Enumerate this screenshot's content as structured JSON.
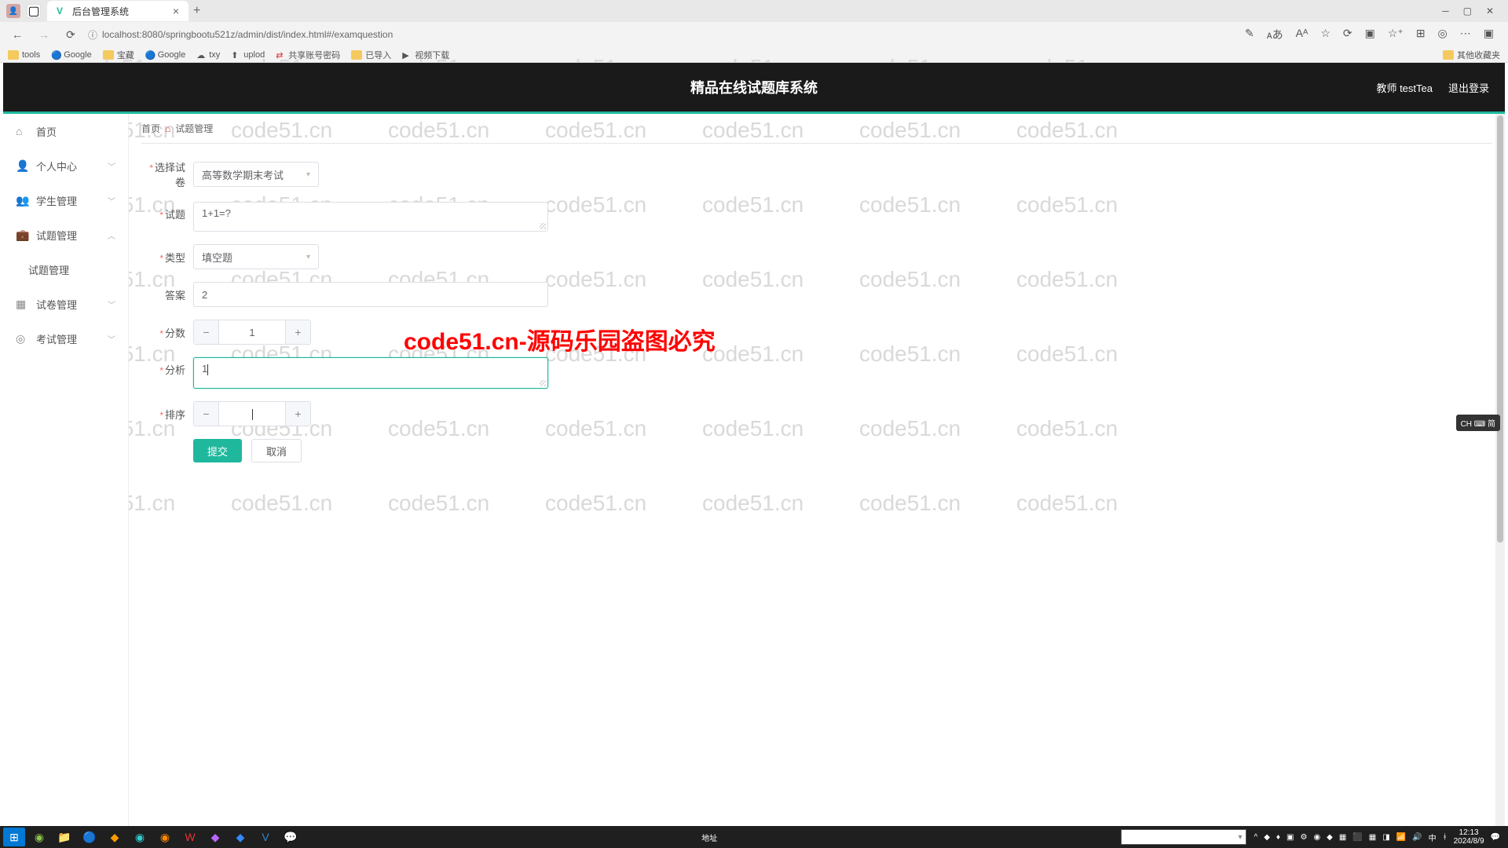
{
  "browser": {
    "tab_title": "后台管理系统",
    "url": "localhost:8080/springbootu521z/admin/dist/index.html#/examquestion",
    "bookmarks": [
      "tools",
      "Google",
      "宝藏",
      "Google",
      "txy",
      "uplod",
      "共享账号密码",
      "已导入",
      "视频下载"
    ],
    "bookmark_right": "其他收藏夹"
  },
  "header": {
    "title": "精品在线试题库系统",
    "user": "教师 testTea",
    "logout": "退出登录"
  },
  "sidebar": {
    "items": [
      {
        "icon": "home",
        "label": "首页"
      },
      {
        "icon": "user",
        "label": "个人中心",
        "arrow": true
      },
      {
        "icon": "group",
        "label": "学生管理",
        "arrow": true
      },
      {
        "icon": "briefcase",
        "label": "试题管理",
        "arrow": true,
        "expanded": true
      },
      {
        "icon": "",
        "label": "试题管理",
        "sub": true
      },
      {
        "icon": "grid",
        "label": "试卷管理",
        "arrow": true
      },
      {
        "icon": "compass",
        "label": "考试管理",
        "arrow": true
      }
    ]
  },
  "breadcrumb": {
    "home": "首页",
    "current": "试题管理"
  },
  "form": {
    "paper_label": "选择试卷",
    "paper_value": "高等数学期末考试",
    "question_label": "试题",
    "question_value": "1+1=?",
    "type_label": "类型",
    "type_value": "填空题",
    "answer_label": "答案",
    "answer_value": "2",
    "score_label": "分数",
    "score_value": "1",
    "analysis_label": "分析",
    "analysis_value": "1",
    "order_label": "排序",
    "order_value": "",
    "submit": "提交",
    "cancel": "取消"
  },
  "watermark": "code51.cn",
  "overlay": "code51.cn-源码乐园盗图必究",
  "ime": "CH ⌨ 简",
  "taskbar": {
    "addr_label": "地址",
    "time": "12:13",
    "date": "2024/8/9"
  }
}
